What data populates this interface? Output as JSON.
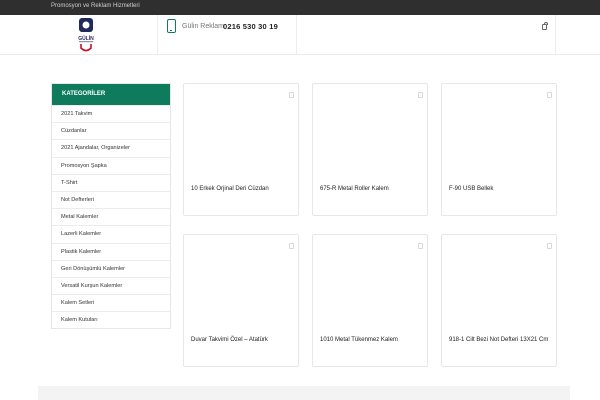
{
  "topbar": {
    "text": "Promosyon ve Reklam Hizmetleri"
  },
  "header": {
    "logo": {
      "name": "gulin-logo",
      "text": "GÜLİN"
    },
    "brand": "Gülin Reklam",
    "phone": "0216 530 30 19",
    "icons": {
      "phone": "mobile-phone-icon",
      "cart": "shopping-bag-icon"
    }
  },
  "sidebar": {
    "title": "KATEGORİLER",
    "items": [
      {
        "label": "2021 Takvim"
      },
      {
        "label": "Cüzdanlar"
      },
      {
        "label": "2021 Ajandalar, Organizeler"
      },
      {
        "label": "Promosyon Şapka"
      },
      {
        "label": "T-Shirt"
      },
      {
        "label": "Not Defterleri"
      },
      {
        "label": "Metal Kalemler"
      },
      {
        "label": "Lazerli Kalemler"
      },
      {
        "label": "Plastik Kalemler"
      },
      {
        "label": "Geri Dönüşümlü Kalemler"
      },
      {
        "label": "Versatil Kurşun Kalemler"
      },
      {
        "label": "Kalem Setleri"
      },
      {
        "label": "Kalem Kutuları"
      }
    ]
  },
  "products": [
    {
      "title": "10 Erkek Orjinal Deri Cüzdan"
    },
    {
      "title": "675-R Metal Roller Kalem"
    },
    {
      "title": "F-90 USB Bellek"
    },
    {
      "title": "Duvar Takvimi Özel – Atatürk"
    },
    {
      "title": "1010 Metal Tükenmez Kalem"
    },
    {
      "title": "918-1 Cilt Bezi Not Defteri 13X21 Cm"
    }
  ],
  "colors": {
    "accent": "#0f7b5d",
    "topbar": "#2f2f2f",
    "logo_red": "#c8102e",
    "logo_navy": "#1f2a5a"
  }
}
